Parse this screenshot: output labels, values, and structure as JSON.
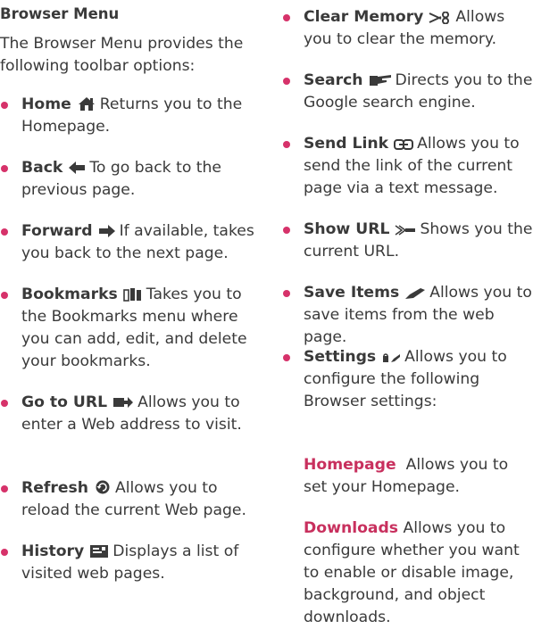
{
  "heading": "Browser Menu",
  "intro": "The Browser Menu provides the following toolbar options:",
  "accent_color": "#d6326a",
  "left_items": [
    {
      "term": "Home",
      "icon": "home-icon",
      "desc": "Returns you to the Homepage."
    },
    {
      "term": "Back",
      "icon": "back-arrow-icon",
      "desc": "To go back to the previous page."
    },
    {
      "term": "Forward",
      "icon": "forward-arrow-icon",
      "desc": "If available, takes you back to the next page."
    },
    {
      "term": "Bookmarks",
      "icon": "bookmarks-icon",
      "desc": "Takes you to the Bookmarks menu where you can add, edit, and delete your bookmarks."
    },
    {
      "term": "Go to URL",
      "icon": "go-to-url-icon",
      "desc": "Allows you to enter a Web address to visit."
    },
    {
      "term": "Refresh",
      "icon": "refresh-icon",
      "desc": "Allows you to reload the current Web page."
    },
    {
      "term": "History",
      "icon": "history-icon",
      "desc": "Displays a list of visited web pages."
    }
  ],
  "right_items": [
    {
      "term": "Clear Memory",
      "icon": "scissors-icon",
      "desc": "Allows you to clear the memory."
    },
    {
      "term": "Search",
      "icon": "search-pointer-icon",
      "desc": "Directs you to the Google search engine."
    },
    {
      "term": "Send Link",
      "icon": "send-link-icon",
      "desc": "Allows you to send the link of the current page via a text message."
    },
    {
      "term": "Show URL",
      "icon": "show-url-icon",
      "desc": "Shows you the current URL."
    },
    {
      "term": "Save Items",
      "icon": "save-items-icon",
      "desc": "Allows you to save items from the web page."
    },
    {
      "term": "Settings",
      "icon": "settings-icon",
      "desc": "Allows you to configure the following Browser settings:"
    }
  ],
  "settings_sub": [
    {
      "term": "Homepage",
      "desc": "Allows you to set your Homepage."
    },
    {
      "term": "Downloads",
      "desc": "Allows you to configure whether you want to enable or disable image, background, and object downloads."
    }
  ]
}
